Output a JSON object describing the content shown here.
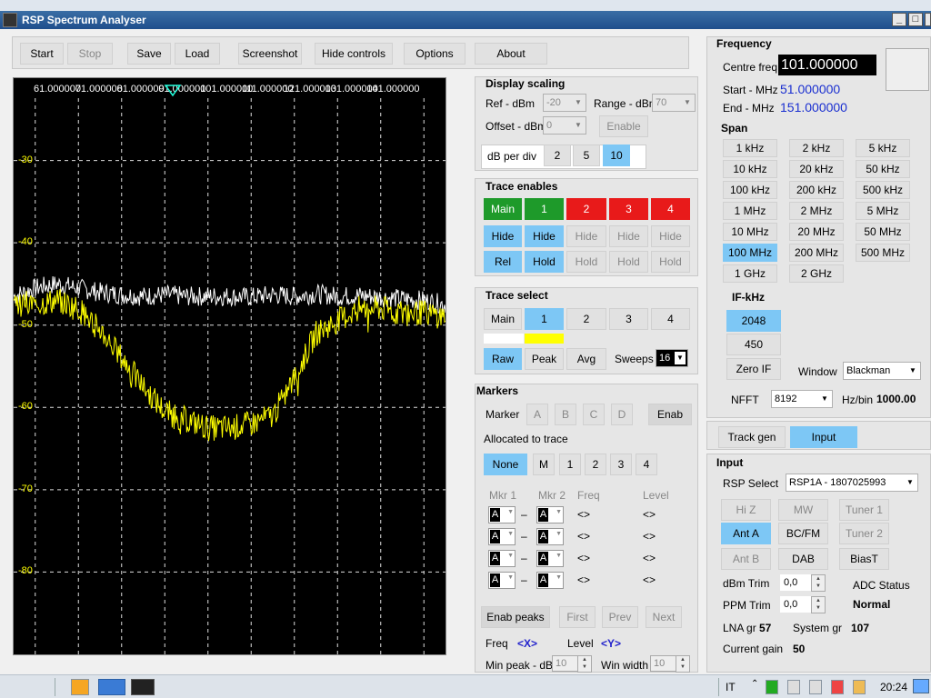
{
  "window": {
    "title": "RSP Spectrum Analyser"
  },
  "toolbar": {
    "start": "Start",
    "stop": "Stop",
    "save": "Save",
    "load": "Load",
    "screenshot": "Screenshot",
    "hide_controls": "Hide controls",
    "options": "Options",
    "about": "About"
  },
  "plot": {
    "freq_labels": [
      "61.000000",
      "71.000000",
      "81.000000",
      "91.000000",
      "101.000000",
      "111.000000",
      "121.000000",
      "131.000000",
      "141.000000"
    ],
    "db_labels": [
      "-30",
      "-40",
      "-50",
      "-60",
      "-70",
      "-80"
    ]
  },
  "chart_data": {
    "type": "line",
    "title": "",
    "xlabel": "",
    "ylabel": "",
    "xlim": [
      51,
      151
    ],
    "ylim": [
      -90,
      -20
    ],
    "grid": true,
    "series": [
      {
        "color": "#ffffff",
        "x": [
          51,
          56,
          61,
          66,
          71,
          76,
          81,
          86,
          91,
          96,
          101,
          106,
          111,
          116,
          121,
          126,
          131,
          136,
          141,
          146,
          151
        ],
        "y": [
          -46.5,
          -45.5,
          -45.0,
          -45.5,
          -46.0,
          -46.3,
          -46.5,
          -46.3,
          -46.5,
          -46.5,
          -46.5,
          -46.6,
          -46.3,
          -46.5,
          -46.2,
          -46.5,
          -46.4,
          -46.6,
          -46.8,
          -47.0,
          -47.5
        ]
      },
      {
        "color": "#ffff00",
        "x": [
          51,
          56,
          61,
          66,
          71,
          76,
          81,
          86,
          91,
          96,
          101,
          106,
          111,
          116,
          121,
          126,
          131,
          136,
          141,
          146,
          151
        ],
        "y": [
          -47.0,
          -47.5,
          -47.0,
          -48.0,
          -50.5,
          -54.0,
          -57.5,
          -60.5,
          -61.5,
          -62.5,
          -62.5,
          -62.0,
          -61.0,
          -56.5,
          -51.0,
          -49.5,
          -48.0,
          -48.0,
          -48.5,
          -48.5,
          -49.0
        ]
      }
    ]
  },
  "display_scaling": {
    "title": "Display scaling",
    "ref_label": "Ref - dBm",
    "ref_value": "-20",
    "range_label": "Range - dBm",
    "range_value": "70",
    "offset_label": "Offset - dBm",
    "offset_value": "0",
    "enable": "Enable",
    "dbdiv_label": "dB per div",
    "dbdiv": [
      "2",
      "5",
      "10"
    ]
  },
  "trace_enables": {
    "title": "Trace enables",
    "row1": [
      "Main",
      "1",
      "2",
      "3",
      "4"
    ],
    "row2": [
      "Hide",
      "Hide",
      "Hide",
      "Hide",
      "Hide"
    ],
    "row3": [
      "Rel",
      "Hold",
      "Hold",
      "Hold",
      "Hold"
    ]
  },
  "trace_select": {
    "title": "Trace select",
    "items": [
      "Main",
      "1",
      "2",
      "3",
      "4"
    ],
    "raw": "Raw",
    "peak": "Peak",
    "avg": "Avg",
    "sweeps_label": "Sweeps",
    "sweeps_value": "16"
  },
  "markers": {
    "title": "Markers",
    "marker_label": "Marker",
    "letters": [
      "A",
      "B",
      "C",
      "D"
    ],
    "enab": "Enab",
    "alloc_label": "Allocated to trace",
    "alloc": [
      "None",
      "M",
      "1",
      "2",
      "3",
      "4"
    ],
    "col_mkr1": "Mkr 1",
    "col_mkr2": "Mkr 2",
    "col_freq": "Freq",
    "col_level": "Level",
    "rows": [
      {
        "m1": "A",
        "m2": "A",
        "dash": "–",
        "freq": "<>",
        "level": "<>"
      },
      {
        "m1": "A",
        "m2": "A",
        "dash": "–",
        "freq": "<>",
        "level": "<>"
      },
      {
        "m1": "A",
        "m2": "A",
        "dash": "–",
        "freq": "<>",
        "level": "<>"
      },
      {
        "m1": "A",
        "m2": "A",
        "dash": "–",
        "freq": "<>",
        "level": "<>"
      }
    ],
    "enab_peaks": "Enab peaks",
    "first": "First",
    "prev": "Prev",
    "next": "Next",
    "freq_label": "Freq",
    "freq_sym": "<X>",
    "level_label": "Level",
    "level_sym": "<Y>",
    "min_peak_label": "Min peak - dB",
    "min_peak_value": "10",
    "win_width_label": "Win width",
    "win_width_value": "10"
  },
  "frequency": {
    "title": "Frequency",
    "centre_label": "Centre freq",
    "centre_value": "101.000000",
    "start_label": "Start - MHz",
    "start_value": "51.000000",
    "end_label": "End - MHz",
    "end_value": "151.000000",
    "span_title": "Span",
    "span": [
      "1 kHz",
      "2 kHz",
      "5 kHz",
      "10 kHz",
      "20 kHz",
      "50 kHz",
      "100 kHz",
      "200 kHz",
      "500 kHz",
      "1 MHz",
      "2 MHz",
      "5 MHz",
      "10 MHz",
      "20 MHz",
      "50 MHz",
      "100 MHz",
      "200 MHz",
      "500 MHz",
      "1 GHz",
      "2 GHz"
    ],
    "if_title": "IF-kHz",
    "if": [
      "2048",
      "450",
      "Zero IF"
    ],
    "window_label": "Window",
    "window_value": "Blackman",
    "nfft_label": "NFFT",
    "nfft_value": "8192",
    "hzbin_label": "Hz/bin",
    "hzbin_value": "1000.00"
  },
  "tabs": {
    "track_gen": "Track gen",
    "input": "Input"
  },
  "input": {
    "title": "Input",
    "rsp_label": "RSP Select",
    "rsp_value": "RSP1A - 1807025993",
    "row1": [
      "Hi Z",
      "MW",
      "Tuner 1"
    ],
    "row2": [
      "Ant A",
      "BC/FM",
      "Tuner 2"
    ],
    "row3": [
      "Ant B",
      "DAB",
      "BiasT"
    ],
    "dbm_trim_label": "dBm Trim",
    "dbm_trim_value": "0,0",
    "ppm_trim_label": "PPM Trim",
    "ppm_trim_value": "0,0",
    "adc_label": "ADC Status",
    "adc_value": "Normal",
    "lna_label": "LNA gr",
    "lna_value": "57",
    "system_label": "System gr",
    "system_value": "107",
    "current_label": "Current gain",
    "current_value": "50"
  },
  "taskbar": {
    "lang": "IT",
    "time": "20:24"
  }
}
